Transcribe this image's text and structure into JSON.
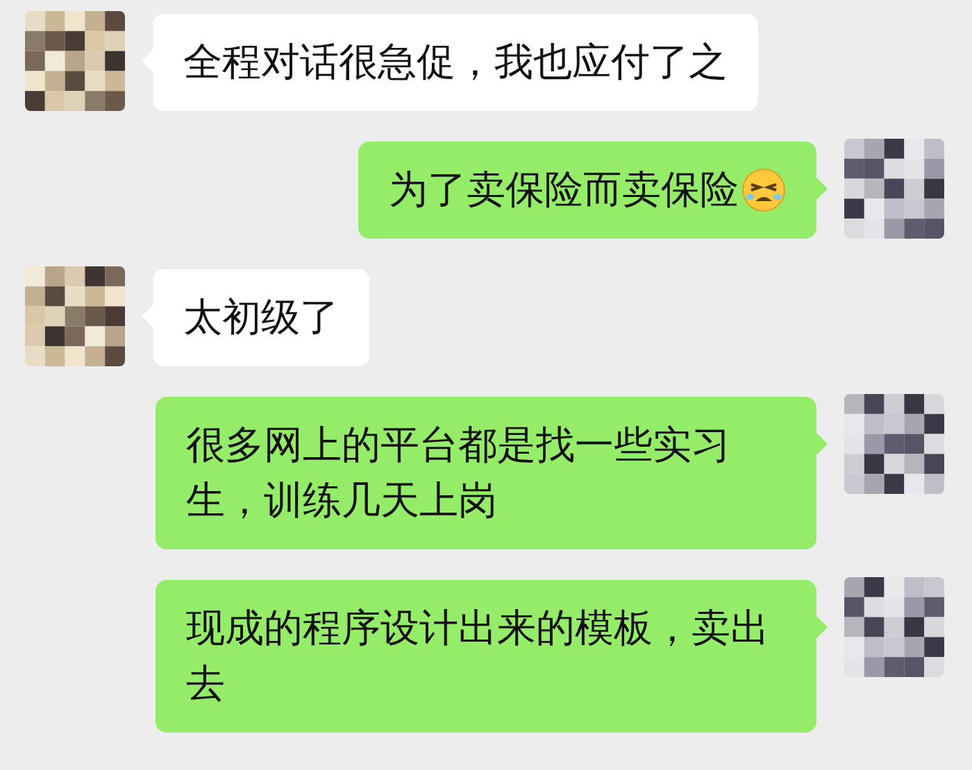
{
  "messages": [
    {
      "kind": "received",
      "text": "全程对话很急促，我也应付了之",
      "has_emoji": false
    },
    {
      "kind": "sent",
      "text": "为了卖保险而卖保险",
      "has_emoji": true
    },
    {
      "kind": "received",
      "text": "太初级了",
      "has_emoji": false
    },
    {
      "kind": "sent",
      "text": "很多网上的平台都是找一些实习生，训练几天上岗",
      "has_emoji": false
    },
    {
      "kind": "sent",
      "text": "现成的程序设计出来的模板，卖出去",
      "has_emoji": false
    }
  ]
}
